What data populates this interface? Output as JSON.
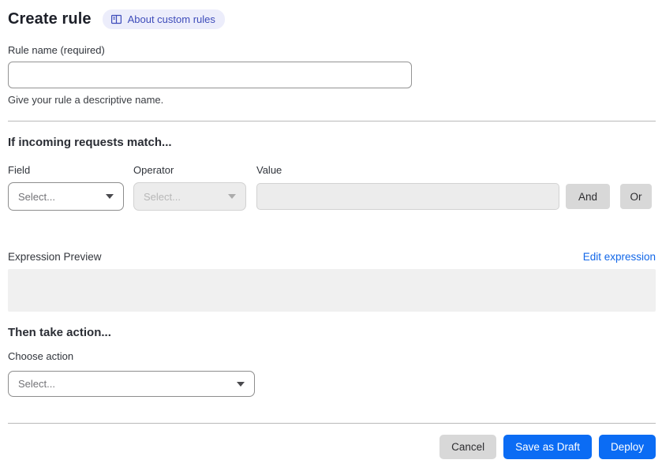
{
  "header": {
    "title": "Create rule",
    "badge_label": "About custom rules"
  },
  "rule_name": {
    "label": "Rule name (required)",
    "value": "",
    "helper": "Give your rule a descriptive name."
  },
  "match_section": {
    "heading": "If incoming requests match...",
    "field_label": "Field",
    "operator_label": "Operator",
    "value_label": "Value",
    "field_placeholder": "Select...",
    "operator_placeholder": "Select...",
    "value_value": "",
    "and_label": "And",
    "or_label": "Or"
  },
  "expression": {
    "label": "Expression Preview",
    "edit_link": "Edit expression",
    "preview": ""
  },
  "action_section": {
    "heading": "Then take action...",
    "choose_label": "Choose action",
    "placeholder": "Select..."
  },
  "footer": {
    "cancel": "Cancel",
    "save_draft": "Save as Draft",
    "deploy": "Deploy"
  },
  "colors": {
    "accent_blue": "#0b6cf4",
    "link_blue": "#1267e8",
    "badge_bg": "#ecedfb",
    "badge_text": "#3e4cba",
    "disabled_bg": "#ececec",
    "preview_bg": "#f0f0f0",
    "chip_gray": "#d8d8d8"
  },
  "icons": {
    "book": "book-icon",
    "caret": "chevron-down-icon"
  }
}
